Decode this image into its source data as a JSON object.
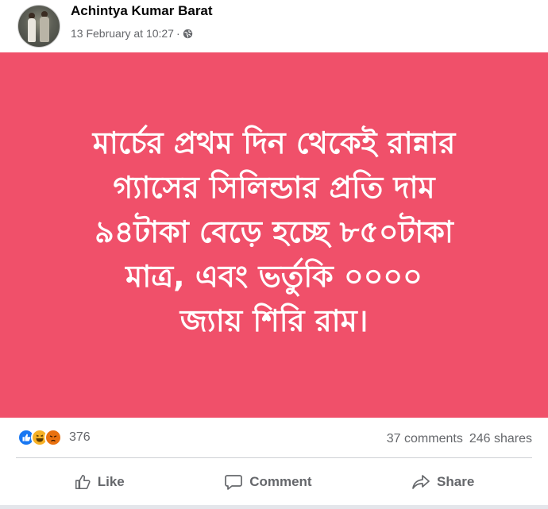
{
  "post": {
    "author": "Achintya Kumar Barat",
    "timestamp": "13 February at 10:27",
    "separator": "·",
    "privacy_icon": "globe-icon"
  },
  "image": {
    "background_color": "#f0506a",
    "text_color": "#ffffff",
    "lines": [
      "মার্চের প্রথম দিন থেকেই রান্নার",
      "গ্যাসের সিলিন্ডার প্রতি দাম",
      "৯৪টাকা বেড়ে হচ্ছে ৮৫০টাকা",
      "মাত্র, এবং ভর্তুকি ০০০০",
      "জ্যায় শিরি রাম।"
    ]
  },
  "stats": {
    "reaction_icons": [
      "like-icon",
      "haha-icon",
      "angry-icon"
    ],
    "reaction_count": "376",
    "comments": "37 comments",
    "shares": "246 shares"
  },
  "actions": {
    "like": "Like",
    "comment": "Comment",
    "share": "Share"
  },
  "colors": {
    "like_blue": "#1877f2",
    "secondary_text": "#65676b"
  }
}
